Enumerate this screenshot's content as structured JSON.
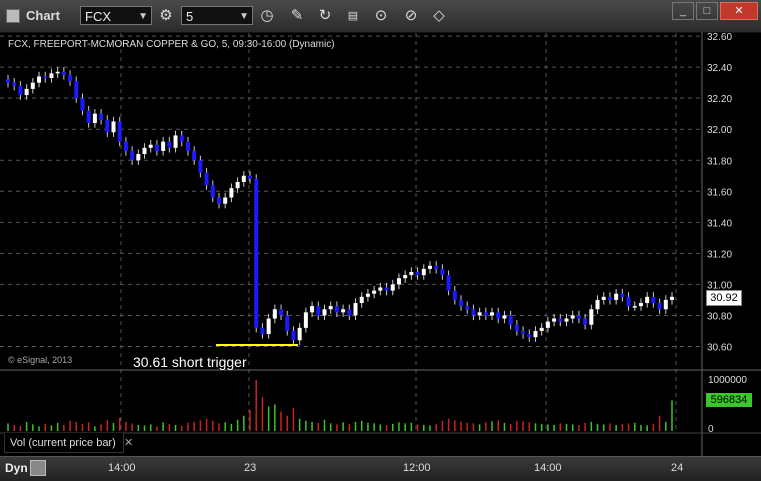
{
  "toolbar": {
    "title": "Chart",
    "symbol": "FCX",
    "interval": "5"
  },
  "chart_header": "FCX, FREEPORT-MCMORAN COPPER & GO, 5, 09:30-16:00 (Dynamic)",
  "watermark": "© eSignal, 2013",
  "annotation": "30.61 short trigger",
  "last_price": "30.92",
  "last_volume": "596834",
  "volume_axis": [
    "1000000",
    "0"
  ],
  "study_label": "Vol (current price bar)",
  "bottom": {
    "mode": "Dyn",
    "x_ticks": [
      "14:00",
      "23",
      "12:00",
      "14:00",
      "24"
    ]
  },
  "colors": {
    "up": "#ffffff",
    "down": "#1a1aff",
    "vol_up": "#3cc52c",
    "vol_down": "#cc2222",
    "trigger_line": "#ffff00"
  },
  "chart_data": [
    {
      "type": "candlestick",
      "title": "FCX, FREEPORT-MCMORAN COPPER & GO, 5, 09:30-16:00 (Dynamic)",
      "y_ticks": [
        "32.60",
        "32.40",
        "32.20",
        "32.00",
        "31.80",
        "31.60",
        "31.40",
        "31.20",
        "31.00",
        "30.80",
        "30.60"
      ],
      "ylim": [
        30.5,
        32.62
      ],
      "x_ticks": [
        "14:00",
        "23",
        "12:00",
        "14:00",
        "24"
      ],
      "grid": true,
      "closes": [
        32.3,
        32.28,
        32.22,
        32.26,
        32.3,
        32.34,
        32.33,
        32.36,
        32.37,
        32.35,
        32.31,
        32.2,
        32.12,
        32.04,
        32.1,
        32.06,
        31.98,
        32.05,
        31.92,
        31.86,
        31.8,
        31.84,
        31.88,
        31.9,
        31.86,
        31.92,
        31.88,
        31.96,
        31.92,
        31.86,
        31.8,
        31.72,
        31.64,
        31.56,
        31.52,
        31.56,
        31.62,
        31.66,
        31.7,
        31.68,
        30.72,
        30.68,
        30.78,
        30.84,
        30.8,
        30.7,
        30.64,
        30.72,
        30.82,
        30.86,
        30.8,
        30.84,
        30.86,
        30.82,
        30.84,
        30.8,
        30.88,
        30.92,
        30.94,
        30.96,
        30.98,
        30.96,
        31.0,
        31.04,
        31.06,
        31.08,
        31.06,
        31.1,
        31.12,
        31.1,
        31.06,
        30.96,
        30.9,
        30.86,
        30.84,
        30.8,
        30.82,
        30.8,
        30.82,
        30.78,
        30.8,
        30.74,
        30.7,
        30.68,
        30.66,
        30.7,
        30.72,
        30.76,
        30.78,
        30.76,
        30.78,
        30.8,
        30.78,
        30.74,
        30.84,
        30.9,
        30.92,
        30.9,
        30.94,
        30.92,
        30.86,
        30.86,
        30.88,
        30.92,
        30.88,
        30.84,
        30.9,
        30.92
      ],
      "volume_ylim": [
        0,
        1000000
      ],
      "volumes": [
        150000,
        120000,
        100000,
        180000,
        130000,
        90000,
        140000,
        110000,
        160000,
        120000,
        200000,
        180000,
        140000,
        170000,
        90000,
        130000,
        210000,
        160000,
        260000,
        180000,
        150000,
        120000,
        110000,
        130000,
        90000,
        170000,
        140000,
        120000,
        100000,
        160000,
        180000,
        210000,
        240000,
        200000,
        150000,
        170000,
        140000,
        220000,
        300000,
        410000,
        1000000,
        660000,
        480000,
        520000,
        380000,
        300000,
        450000,
        240000,
        200000,
        180000,
        160000,
        220000,
        150000,
        130000,
        170000,
        140000,
        180000,
        200000,
        160000,
        150000,
        130000,
        110000,
        140000,
        170000,
        150000,
        160000,
        130000,
        120000,
        110000,
        140000,
        200000,
        240000,
        210000,
        180000,
        160000,
        150000,
        130000,
        170000,
        190000,
        210000,
        160000,
        140000,
        200000,
        190000,
        170000,
        150000,
        140000,
        130000,
        120000,
        150000,
        140000,
        130000,
        120000,
        160000,
        180000,
        140000,
        130000,
        150000,
        120000,
        140000,
        150000,
        160000,
        120000,
        110000,
        140000,
        300000,
        180000,
        600000
      ]
    }
  ]
}
